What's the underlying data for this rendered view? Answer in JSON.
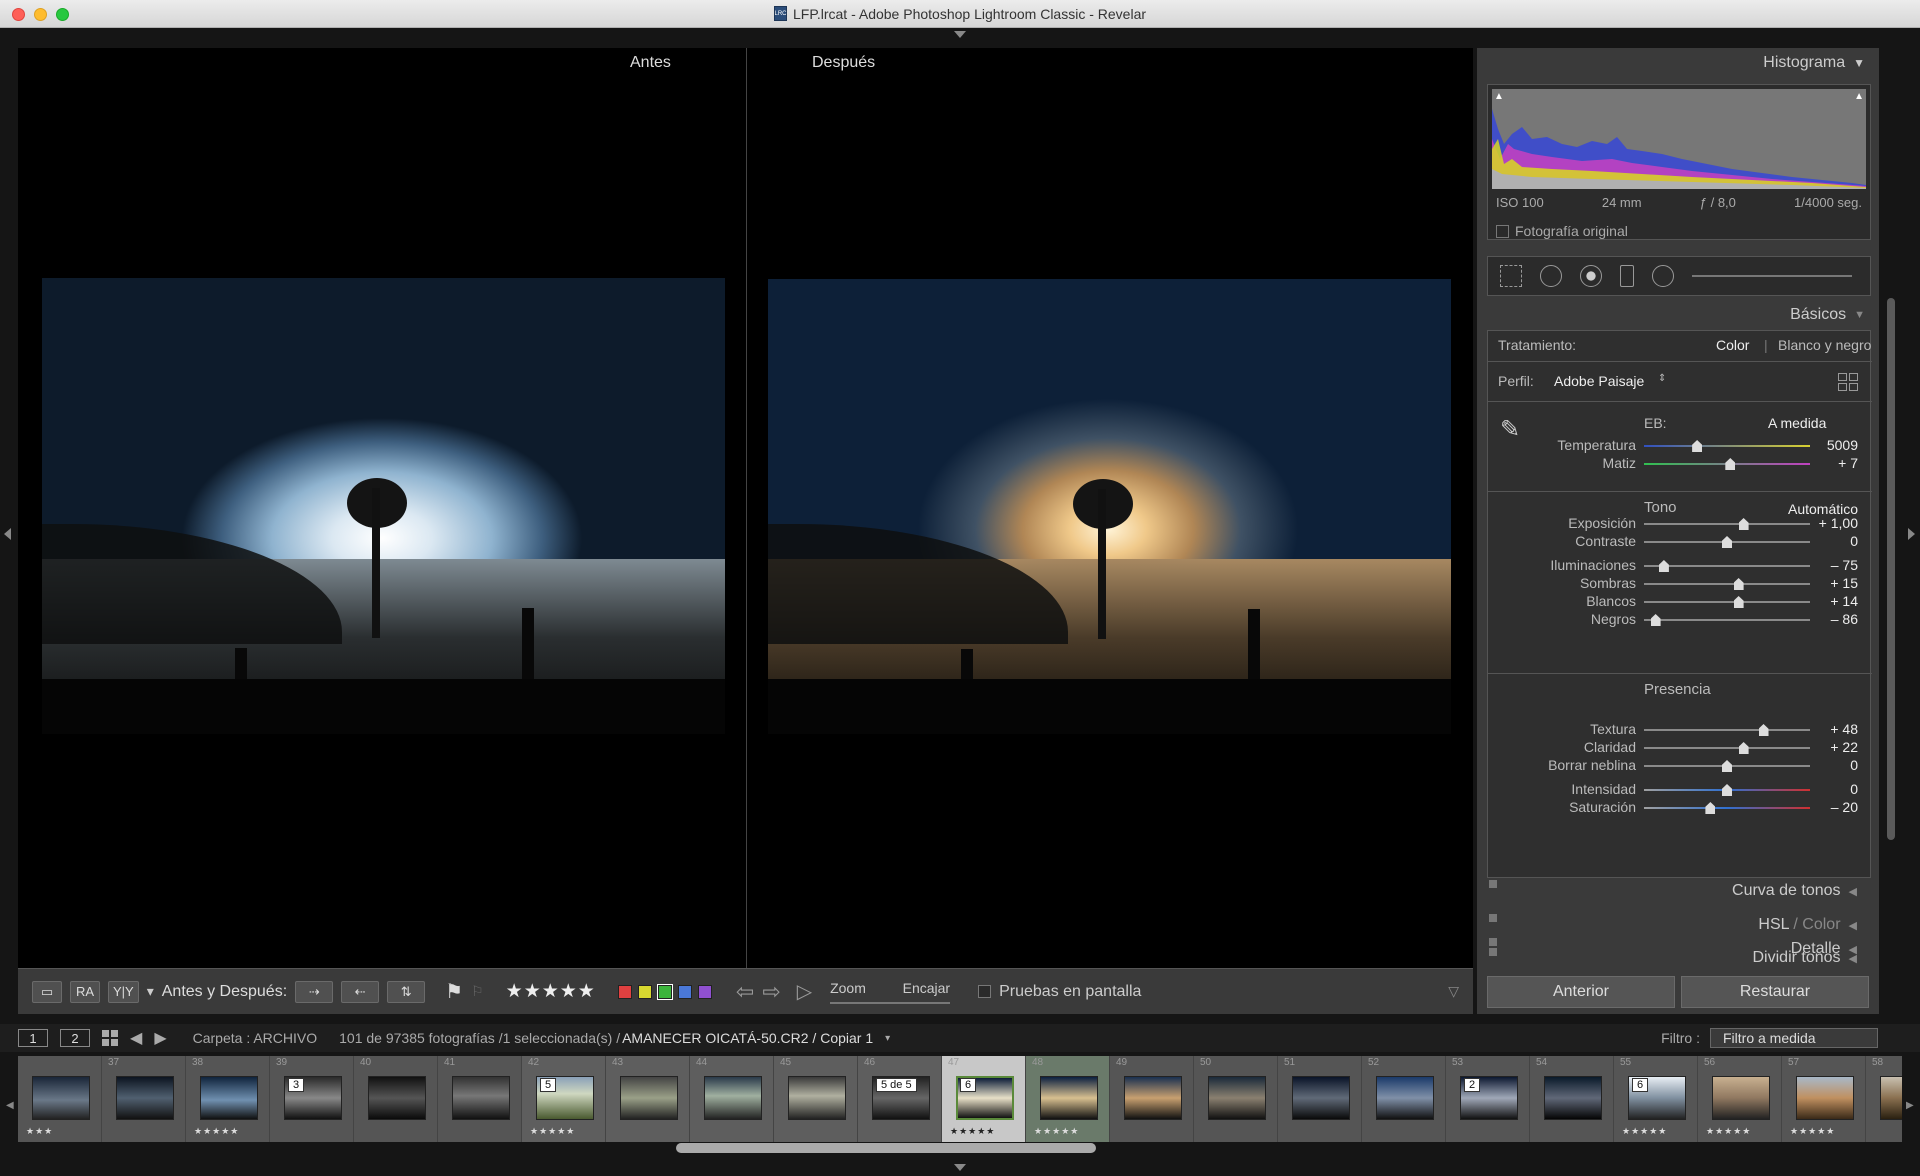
{
  "window": {
    "title": "LFP.lrcat - Adobe Photoshop Lightroom Classic - Revelar",
    "doc_icon_label": "LRC"
  },
  "view": {
    "before_label": "Antes",
    "after_label": "Después"
  },
  "toolbar": {
    "view_mode_label": "RA",
    "yy_label": "Y|Y",
    "before_after_label": "Antes y Después:",
    "stars": "★★★★★",
    "zoom_label": "Zoom",
    "fit_label": "Encajar",
    "soft_proof_label": "Pruebas en pantalla",
    "color_labels": [
      "#e04040",
      "#d8d830",
      "#3cb43c",
      "#4a78d8",
      "#9050d0"
    ]
  },
  "histogram": {
    "title": "Histograma",
    "iso": "ISO 100",
    "focal": "24 mm",
    "aperture": "ƒ / 8,0",
    "shutter": "1/4000 seg.",
    "original_photo": "Fotografía original"
  },
  "basic": {
    "title": "Básicos",
    "treatment_label": "Tratamiento:",
    "treatment_color": "Color",
    "treatment_bw": "Blanco y negro",
    "profile_label": "Perfil:",
    "profile_value": "Adobe Paisaje",
    "wb_label": "EB:",
    "wb_value": "A medida",
    "tone_title": "Tono",
    "tone_auto": "Automático",
    "presence_title": "Presencia",
    "sliders": [
      {
        "label": "Temperatura",
        "value": "5009",
        "pos": 0.32
      },
      {
        "label": "Matiz",
        "value": "+ 7",
        "pos": 0.52
      },
      {
        "label": "Exposición",
        "value": "+ 1,00",
        "pos": 0.6
      },
      {
        "label": "Contraste",
        "value": "0",
        "pos": 0.5
      },
      {
        "label": "Iluminaciones",
        "value": "– 75",
        "pos": 0.12
      },
      {
        "label": "Sombras",
        "value": "+ 15",
        "pos": 0.57
      },
      {
        "label": "Blancos",
        "value": "+ 14",
        "pos": 0.57
      },
      {
        "label": "Negros",
        "value": "– 86",
        "pos": 0.07
      },
      {
        "label": "Textura",
        "value": "+ 48",
        "pos": 0.72
      },
      {
        "label": "Claridad",
        "value": "+ 22",
        "pos": 0.6
      },
      {
        "label": "Borrar neblina",
        "value": "0",
        "pos": 0.5
      },
      {
        "label": "Intensidad",
        "value": "0",
        "pos": 0.5
      },
      {
        "label": "Saturación",
        "value": "– 20",
        "pos": 0.4
      }
    ]
  },
  "panels": {
    "tone_curve": "Curva de tonos",
    "hsl": "HSL",
    "hsl_color": "/ Color",
    "split_toning": "Dividir tonos",
    "detail": "Detalle"
  },
  "buttons": {
    "previous": "Anterior",
    "reset": "Restaurar"
  },
  "filmbar": {
    "monitor1": "1",
    "monitor2": "2",
    "folder": "Carpeta : ARCHIVO",
    "count": "101 de 97385 fotografías /1 seleccionada(s) /",
    "file": "AMANECER OICATÁ-50.CR2 / Copiar 1",
    "filter_label": "Filtro :",
    "filter_value": "Filtro a medida"
  },
  "filmstrip": [
    {
      "num": "",
      "stars": "★★★",
      "badge": ""
    },
    {
      "num": "37",
      "stars": "",
      "badge": ""
    },
    {
      "num": "38",
      "stars": "★★★★★",
      "badge": ""
    },
    {
      "num": "39",
      "stars": "",
      "badge": "3"
    },
    {
      "num": "40",
      "stars": "",
      "badge": ""
    },
    {
      "num": "41",
      "stars": "",
      "badge": ""
    },
    {
      "num": "42",
      "stars": "★★★★★",
      "badge": "5"
    },
    {
      "num": "43",
      "stars": "",
      "badge": ""
    },
    {
      "num": "44",
      "stars": "",
      "badge": ""
    },
    {
      "num": "45",
      "stars": "",
      "badge": ""
    },
    {
      "num": "46",
      "stars": "",
      "badge": "5 de 5"
    },
    {
      "num": "47",
      "stars": "★★★★★",
      "badge": "6"
    },
    {
      "num": "48",
      "stars": "★★★★★",
      "badge": ""
    },
    {
      "num": "49",
      "stars": "",
      "badge": ""
    },
    {
      "num": "50",
      "stars": "",
      "badge": ""
    },
    {
      "num": "51",
      "stars": "",
      "badge": ""
    },
    {
      "num": "52",
      "stars": "",
      "badge": ""
    },
    {
      "num": "53",
      "stars": "",
      "badge": "2"
    },
    {
      "num": "54",
      "stars": "",
      "badge": ""
    },
    {
      "num": "55",
      "stars": "★★★★★",
      "badge": "6"
    },
    {
      "num": "56",
      "stars": "★★★★★",
      "badge": ""
    },
    {
      "num": "57",
      "stars": "★★★★★",
      "badge": ""
    },
    {
      "num": "58",
      "stars": "",
      "badge": ""
    }
  ]
}
